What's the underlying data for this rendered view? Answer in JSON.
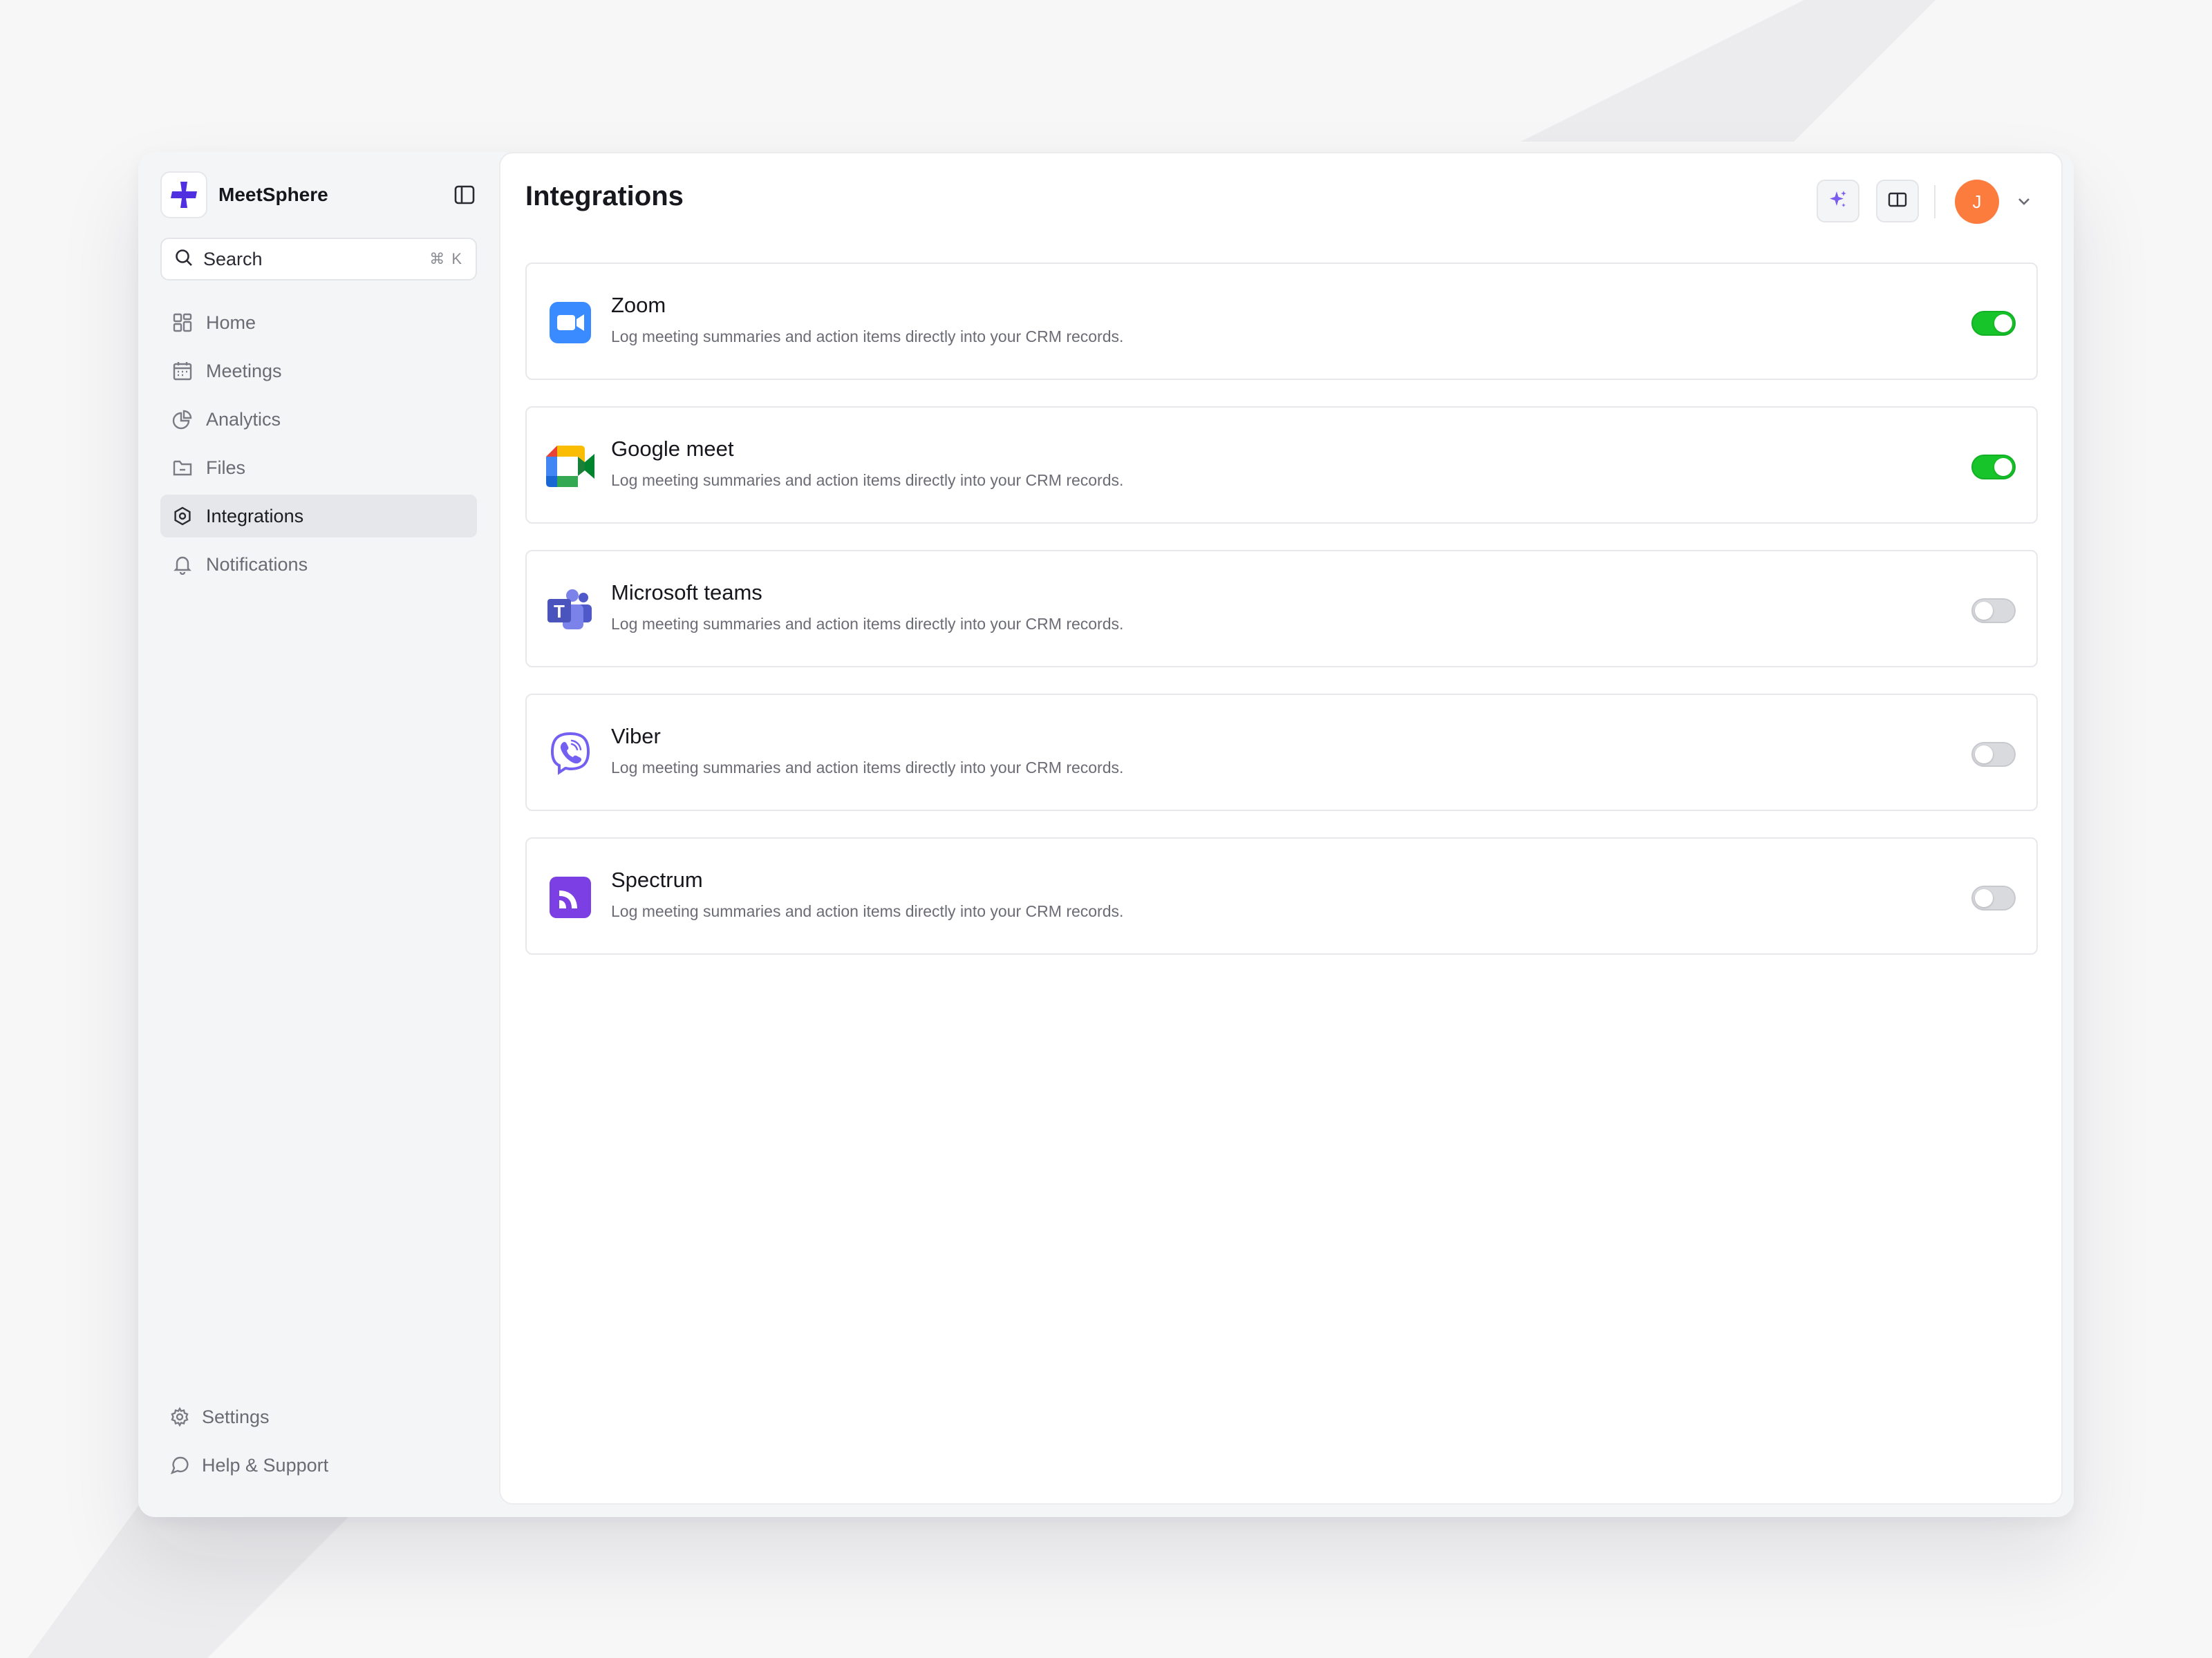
{
  "app": {
    "name": "MeetSphere"
  },
  "search": {
    "placeholder": "Search",
    "shortcut": "⌘ K"
  },
  "sidebar": {
    "items": [
      {
        "label": "Home",
        "icon": "grid-icon",
        "active": false
      },
      {
        "label": "Meetings",
        "icon": "calendar-icon",
        "active": false
      },
      {
        "label": "Analytics",
        "icon": "pie-chart-icon",
        "active": false
      },
      {
        "label": "Files",
        "icon": "folder-icon",
        "active": false
      },
      {
        "label": "Integrations",
        "icon": "integrations-icon",
        "active": true
      },
      {
        "label": "Notifications",
        "icon": "bell-icon",
        "active": false
      }
    ],
    "bottom": [
      {
        "label": "Settings",
        "icon": "gear-icon"
      },
      {
        "label": "Help & Support",
        "icon": "chat-support-icon"
      }
    ]
  },
  "header": {
    "title": "Integrations",
    "avatar_initial": "J"
  },
  "integrations": [
    {
      "name": "Zoom",
      "description": "Log meeting summaries and action items directly into your CRM records.",
      "enabled": true,
      "icon": "zoom-logo"
    },
    {
      "name": "Google meet",
      "description": "Log meeting summaries and action items directly into your CRM records.",
      "enabled": true,
      "icon": "google-meet-logo"
    },
    {
      "name": "Microsoft teams",
      "description": "Log meeting summaries and action items directly into your CRM records.",
      "enabled": false,
      "icon": "microsoft-teams-logo"
    },
    {
      "name": "Viber",
      "description": "Log meeting summaries and action items directly into your CRM records.",
      "enabled": false,
      "icon": "viber-logo"
    },
    {
      "name": "Spectrum",
      "description": "Log meeting summaries and action items directly into your CRM records.",
      "enabled": false,
      "icon": "spectrum-logo"
    }
  ],
  "colors": {
    "brand": "#4f2fe0",
    "toggle_on": "#17c42a",
    "toggle_off": "#d9dade",
    "avatar": "#fb7c3d",
    "sparkle": "#7b5cf0"
  }
}
